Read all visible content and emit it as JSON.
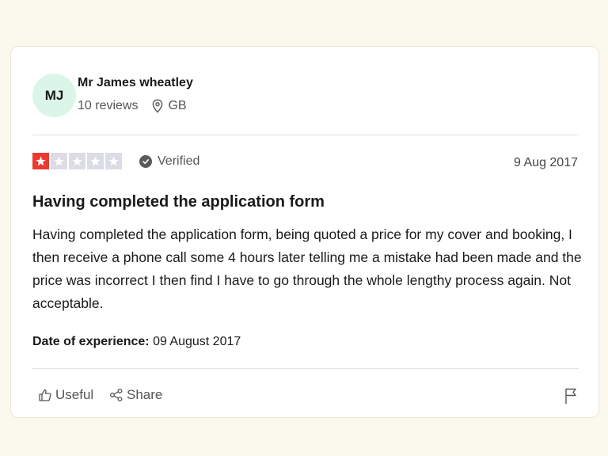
{
  "reviewer": {
    "initials": "MJ",
    "name": "Mr James wheatley",
    "reviews_count": "10 reviews",
    "country": "GB",
    "avatar_color": "#dcf5e9"
  },
  "review": {
    "rating": 1,
    "max_rating": 5,
    "star_color": "#ea3b2e",
    "verified_label": "Verified",
    "date": "9 Aug 2017",
    "title": "Having completed the application form",
    "body": "Having completed the application form, being quoted a price for my cover and booking, I then receive a phone call some 4 hours later telling me a mistake had been made and the price was incorrect I then find I have to go through the whole lengthy process again. Not acceptable.",
    "experience_label": "Date of experience:",
    "experience_date": "09 August 2017"
  },
  "actions": {
    "useful_label": "Useful",
    "share_label": "Share",
    "useful_icon": "thumbs-up-icon",
    "share_icon": "share-icon",
    "report_icon": "flag-icon"
  }
}
